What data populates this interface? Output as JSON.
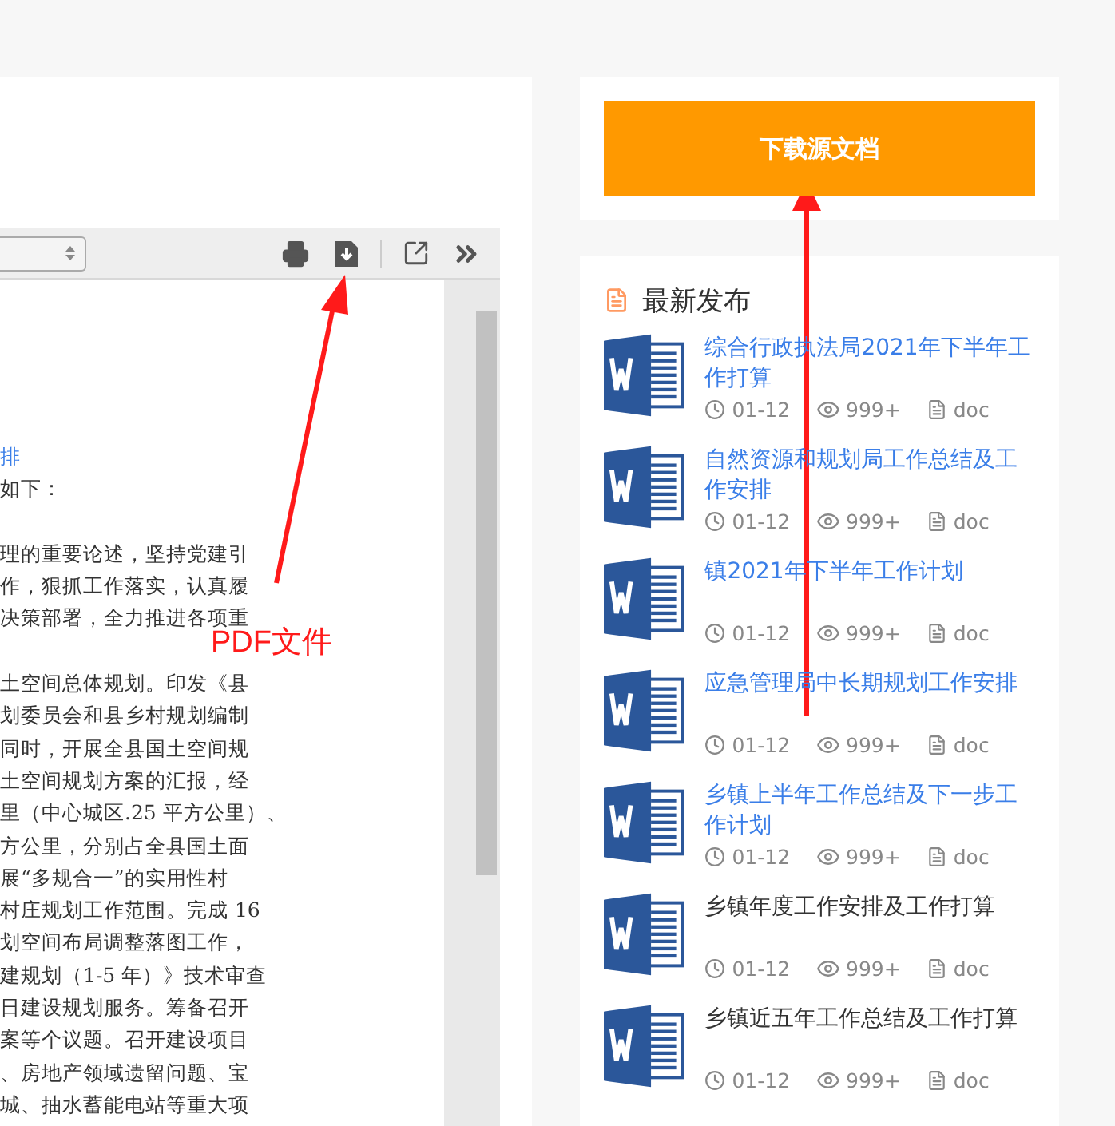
{
  "pdf_viewer": {
    "document_lines": [
      {
        "text": "排",
        "kind": "link"
      },
      {
        "text": "如下：",
        "kind": "body"
      },
      {
        "kind": "gap"
      },
      {
        "text": "理的重要论述，坚持党建引",
        "kind": "body"
      },
      {
        "text": "作，狠抓工作落实，认真履",
        "kind": "body"
      },
      {
        "text": "决策部署，全力推进各项重",
        "kind": "body"
      },
      {
        "kind": "gap"
      },
      {
        "text": "土空间总体规划。印发《县",
        "kind": "body"
      },
      {
        "text": "划委员会和县乡村规划编制",
        "kind": "body"
      },
      {
        "text": "同时，开展全县国土空间规",
        "kind": "body"
      },
      {
        "text": "土空间规划方案的汇报，经",
        "kind": "body"
      },
      {
        "text": "里（中心城区.25 平方公里）、",
        "kind": "body"
      },
      {
        "text": "方公里，分别占全县国土面",
        "kind": "body"
      },
      {
        "text": "展“多规合一”的实用性村",
        "kind": "body"
      },
      {
        "text": "村庄规划工作范围。完成 16",
        "kind": "body"
      },
      {
        "text": "划空间布局调整落图工作，",
        "kind": "body"
      },
      {
        "text": "建规划（1-5 年）》技术审查",
        "kind": "body"
      },
      {
        "text": "日建设规划服务。筹备召开",
        "kind": "body"
      },
      {
        "text": "案等个议题。召开建设项目",
        "kind": "body"
      },
      {
        "text": "、房地产领域遗留问题、宝",
        "kind": "body"
      },
      {
        "text": "城、抽水蓄能电站等重大项",
        "kind": "body"
      }
    ]
  },
  "annotation": {
    "label": "PDF文件"
  },
  "download_button": {
    "label": "下载源文档"
  },
  "latest": {
    "title": "最新发布",
    "items": [
      {
        "title": "综合行政执法局2021年下半年工作打算",
        "visited": true,
        "date": "01-12",
        "views": "999+",
        "format": "doc"
      },
      {
        "title": "自然资源和规划局工作总结及工作安排",
        "visited": true,
        "date": "01-12",
        "views": "999+",
        "format": "doc"
      },
      {
        "title": "镇2021年下半年工作计划",
        "visited": true,
        "date": "01-12",
        "views": "999+",
        "format": "doc"
      },
      {
        "title": "应急管理局中长期规划工作安排",
        "visited": true,
        "date": "01-12",
        "views": "999+",
        "format": "doc"
      },
      {
        "title": "乡镇上半年工作总结及下一步工作计划",
        "visited": true,
        "date": "01-12",
        "views": "999+",
        "format": "doc"
      },
      {
        "title": "乡镇年度工作安排及工作打算",
        "visited": false,
        "date": "01-12",
        "views": "999+",
        "format": "doc"
      },
      {
        "title": "乡镇近五年工作总结及工作打算",
        "visited": false,
        "date": "01-12",
        "views": "999+",
        "format": "doc"
      }
    ]
  }
}
